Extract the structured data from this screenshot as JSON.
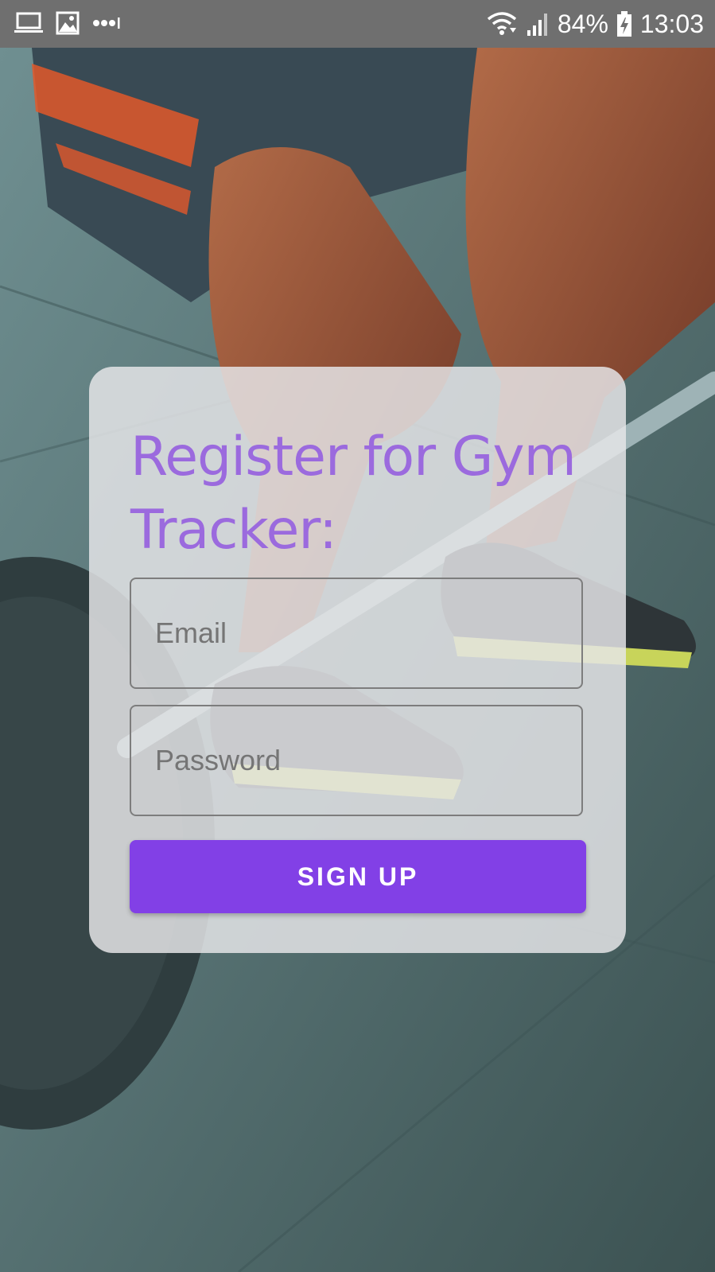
{
  "status_bar": {
    "battery_percent": "84%",
    "time": "13:03",
    "left_icons": [
      "laptop-icon",
      "image-icon",
      "more-dots-icon"
    ],
    "right_icons": [
      "wifi-icon",
      "signal-icon",
      "battery-charging-icon"
    ]
  },
  "card": {
    "title": "Register for Gym Tracker:",
    "email_placeholder": "Email",
    "password_placeholder": "Password",
    "signup_label": "SIGN UP"
  },
  "colors": {
    "accent": "#8240e6",
    "title": "#9b6ade",
    "status_bar": "#6f6f6f"
  }
}
